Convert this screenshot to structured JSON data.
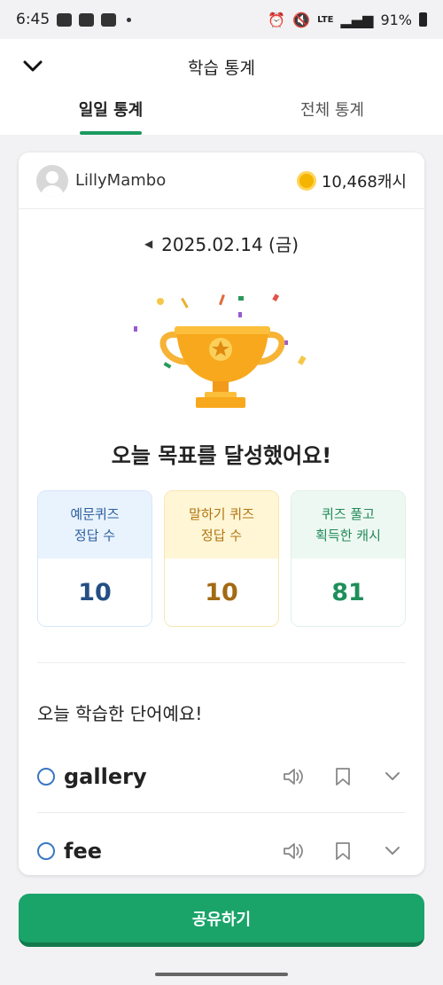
{
  "status_bar": {
    "time": "6:45",
    "talk_badge": "TALK",
    "battery": "91%",
    "network": "LTE"
  },
  "header": {
    "title": "학습 통계",
    "tabs": [
      {
        "label": "일일 통계",
        "active": true
      },
      {
        "label": "전체 통계",
        "active": false
      }
    ]
  },
  "profile": {
    "username": "LillyMambo",
    "cash": "10,468캐시"
  },
  "date": {
    "label": "2025.02.14 (금)"
  },
  "goal_message": "오늘 목표를 달성했어요!",
  "stats": [
    {
      "line1": "예문퀴즈",
      "line2": "정답 수",
      "value": "10",
      "color": "#244e85"
    },
    {
      "line1": "말하기 퀴즈",
      "line2": "정답 수",
      "value": "10",
      "color": "#a36a12"
    },
    {
      "line1": "퀴즈 풀고",
      "line2": "획득한 캐시",
      "value": "81",
      "color": "#1f8f5a"
    }
  ],
  "words_section": {
    "title": "오늘 학습한 단어예요!",
    "words": [
      {
        "word": "gallery"
      },
      {
        "word": "fee"
      }
    ]
  },
  "share_button": "공유하기",
  "colors": {
    "accent": "#1aa46a",
    "tab_underline": "#1a9a60",
    "trophy": "#f8a81c"
  }
}
